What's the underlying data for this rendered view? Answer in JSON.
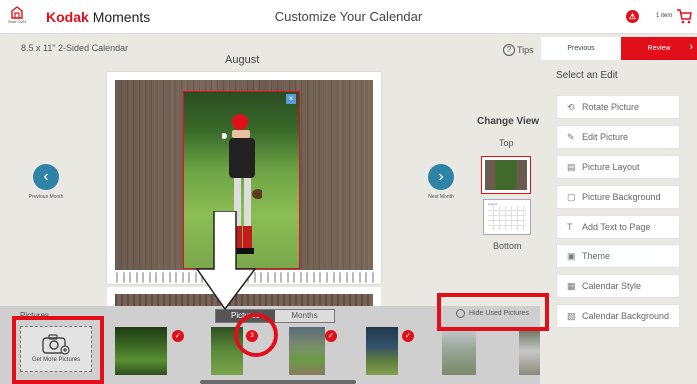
{
  "header": {
    "home_label": "Start Over",
    "brand_kodak": "Kodak",
    "brand_moments": "Moments",
    "title": "Customize Your Calendar",
    "notification_count": "",
    "cart_text": "1 item"
  },
  "product": {
    "title": "8.5 x 11\" 2-Sided Calendar"
  },
  "calendar": {
    "month": "August"
  },
  "tips_label": "Tips",
  "nav": {
    "previous": "Previous",
    "review": "Review"
  },
  "month_nav": {
    "previous": "Previous Month",
    "next": "Next Month"
  },
  "change_view": {
    "title": "Change View",
    "top": "Top",
    "bottom": "Bottom",
    "thumb_caption": "August"
  },
  "edit_panel": {
    "title": "Select an Edit",
    "items": [
      {
        "label": "Rotate Picture",
        "icon": "rotate-icon"
      },
      {
        "label": "Edit Picture",
        "icon": "edit-icon"
      },
      {
        "label": "Picture Layout",
        "icon": "layout-icon"
      },
      {
        "label": "Picture Background",
        "icon": "background-icon"
      },
      {
        "label": "Add Text to Page",
        "icon": "text-icon"
      },
      {
        "label": "Theme",
        "icon": "theme-icon"
      },
      {
        "label": "Calendar Style",
        "icon": "calendar-style-icon"
      },
      {
        "label": "Calendar Background",
        "icon": "calendar-background-icon"
      }
    ]
  },
  "strip": {
    "pictures_label": "Pictures",
    "tabs": [
      "Pictures",
      "Months"
    ],
    "hide_used": "Hide Used Pictures",
    "get_more": "Get More Pictures",
    "badge_count": "3"
  },
  "colors": {
    "accent": "#e20f1a",
    "nav_circle": "#2f84a6"
  }
}
